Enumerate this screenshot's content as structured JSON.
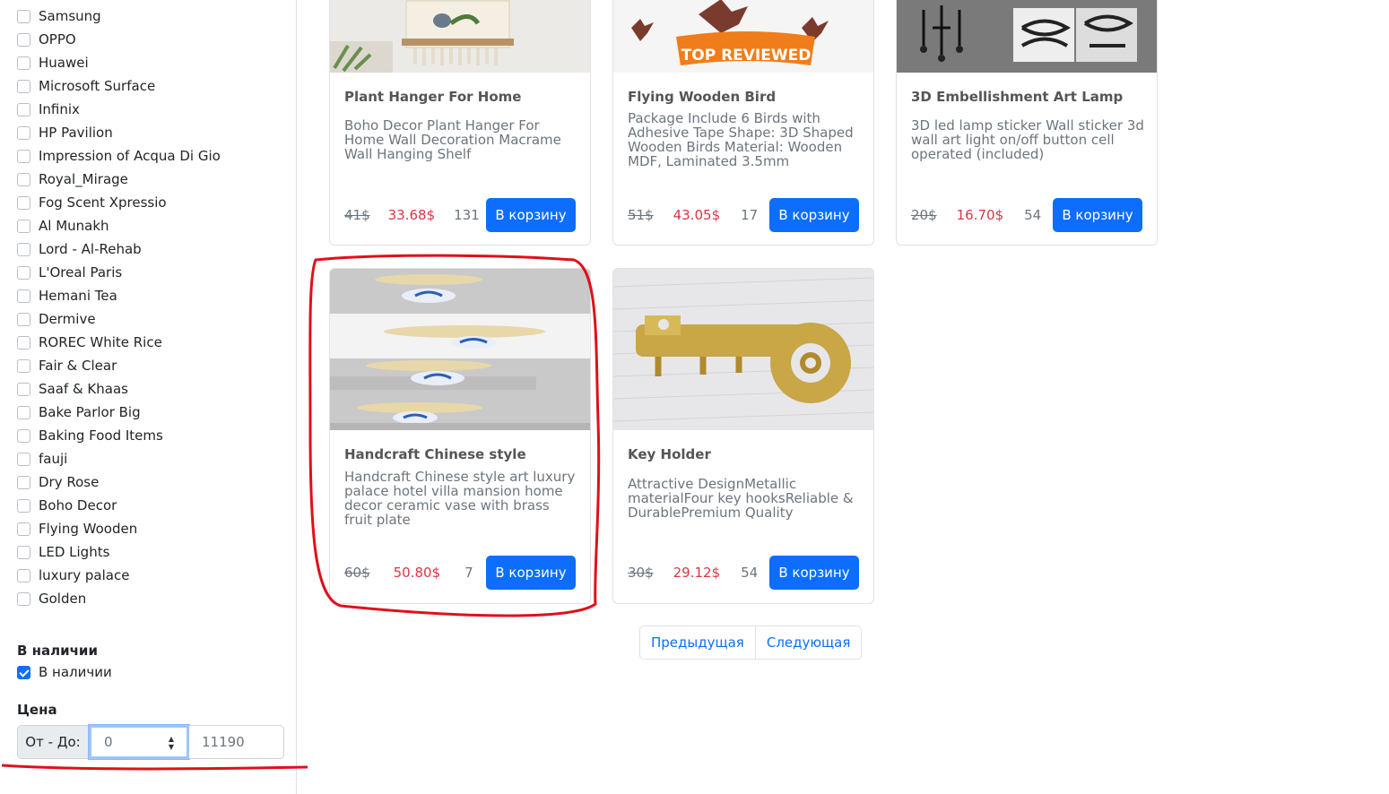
{
  "sidebar": {
    "brands": [
      "Samsung",
      "OPPO",
      "Huawei",
      "Microsoft Surface",
      "Infinix",
      "HP Pavilion",
      "Impression of Acqua Di Gio",
      "Royal_Mirage",
      "Fog Scent Xpressio",
      "Al Munakh",
      "Lord - Al-Rehab",
      "L'Oreal Paris",
      "Hemani Tea",
      "Dermive",
      "ROREC White Rice",
      "Fair & Clear",
      "Saaf & Khaas",
      "Bake Parlor Big",
      "Baking Food Items",
      "fauji",
      "Dry Rose",
      "Boho Decor",
      "Flying Wooden",
      "LED Lights",
      "luxury palace",
      "Golden"
    ],
    "stock_title": "В наличии",
    "stock_label": "В наличии",
    "stock_checked": true,
    "price_title": "Цена",
    "price_label": "От - До:",
    "price_from_placeholder": "0",
    "price_to_placeholder": "11190"
  },
  "products": [
    {
      "title": "Plant Hanger For Home",
      "description": "Boho Decor Plant Hanger For Home Wall Decoration Macrame Wall Hanging Shelf",
      "old_price": "41$",
      "price": "33.68$",
      "stock": "131",
      "button": "В корзину"
    },
    {
      "title": "Flying Wooden Bird",
      "description": "Package Include 6 Birds with Adhesive Tape Shape: 3D Shaped Wooden Birds Material: Wooden MDF, Laminated 3.5mm",
      "old_price": "51$",
      "price": "43.05$",
      "stock": "17",
      "button": "В корзину",
      "image_badge": "TOP REVIEWED"
    },
    {
      "title": "3D Embellishment Art Lamp",
      "description": "3D led lamp sticker Wall sticker 3d wall art light on/off button cell operated (included)",
      "old_price": "20$",
      "price": "16.70$",
      "stock": "54",
      "button": "В корзину"
    },
    {
      "title": "Handcraft Chinese style",
      "description": "Handcraft Chinese style art luxury palace hotel villa mansion home decor ceramic vase with brass fruit plate",
      "old_price": "60$",
      "price": "50.80$",
      "stock": "7",
      "button": "В корзину"
    },
    {
      "title": "Key Holder",
      "description": "Attractive DesignMetallic materialFour key hooksReliable & DurablePremium Quality",
      "old_price": "30$",
      "price": "29.12$",
      "stock": "54",
      "button": "В корзину"
    }
  ],
  "pagination": {
    "prev": "Предыдущая",
    "next": "Следующая"
  },
  "colors": {
    "primary": "#0d6efd",
    "sale": "#dc3545",
    "annotation": "#e0101a"
  }
}
